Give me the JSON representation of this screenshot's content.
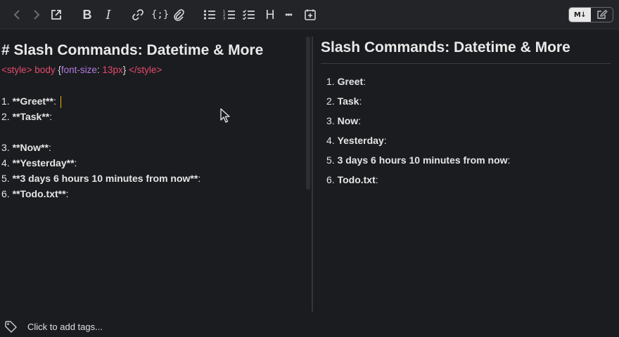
{
  "toolbar": {
    "buttons": [
      {
        "name": "back-icon",
        "glyph": "‹"
      },
      {
        "name": "forward-icon",
        "glyph": "›"
      },
      {
        "name": "open-external-icon"
      },
      {
        "name": "bold-icon",
        "glyph": "B"
      },
      {
        "name": "italic-icon",
        "glyph": "I"
      },
      {
        "name": "link-icon"
      },
      {
        "name": "code-block-icon",
        "glyph": "{;}"
      },
      {
        "name": "attachment-icon"
      },
      {
        "name": "bullet-list-icon"
      },
      {
        "name": "numbered-list-icon"
      },
      {
        "name": "checklist-icon"
      },
      {
        "name": "heading-icon",
        "glyph": "H"
      },
      {
        "name": "more-icon",
        "glyph": "•••"
      },
      {
        "name": "insert-date-icon"
      }
    ],
    "mode_toggle": {
      "markdown_label": "M↓",
      "edit_icon": "edit-icon"
    }
  },
  "editor": {
    "heading": "# Slash Commands: Datetime & More",
    "style_line": {
      "open_tag": "<style>",
      "selector": "body",
      "brace_open": "{",
      "property": "font-size",
      "colon": ":",
      "value": "13px",
      "brace_close": "}",
      "close_tag": "</style>"
    },
    "lines": [
      {
        "number": "1.",
        "text": "**Greet**",
        "suffix": ":"
      },
      {
        "number": "2.",
        "text": "**Task**",
        "suffix": ":"
      },
      {
        "number": "3.",
        "text": "**Now**",
        "suffix": ":"
      },
      {
        "number": "4.",
        "text": "**Yesterday**",
        "suffix": ":"
      },
      {
        "number": "5.",
        "text": "**3 days 6 hours 10 minutes from now**",
        "suffix": ":"
      },
      {
        "number": "6.",
        "text": "**Todo.txt**",
        "suffix": ":"
      }
    ]
  },
  "preview": {
    "heading": "Slash Commands: Datetime & More",
    "items": [
      {
        "number": "1.",
        "text": "Greet",
        "suffix": ":"
      },
      {
        "number": "2.",
        "text": "Task",
        "suffix": ":"
      },
      {
        "number": "3.",
        "text": "Now",
        "suffix": ":"
      },
      {
        "number": "4.",
        "text": "Yesterday",
        "suffix": ":"
      },
      {
        "number": "5.",
        "text": "3 days 6 hours 10 minutes from now",
        "suffix": ":"
      },
      {
        "number": "6.",
        "text": "Todo.txt",
        "suffix": ":"
      }
    ]
  },
  "footer": {
    "tags_label": "Click to add tags..."
  },
  "colors": {
    "background": "#1b1c20",
    "toolbar": "#232428",
    "tag_red": "#e64a6b",
    "property_purple": "#b27be0",
    "cursor": "#f0b400"
  }
}
